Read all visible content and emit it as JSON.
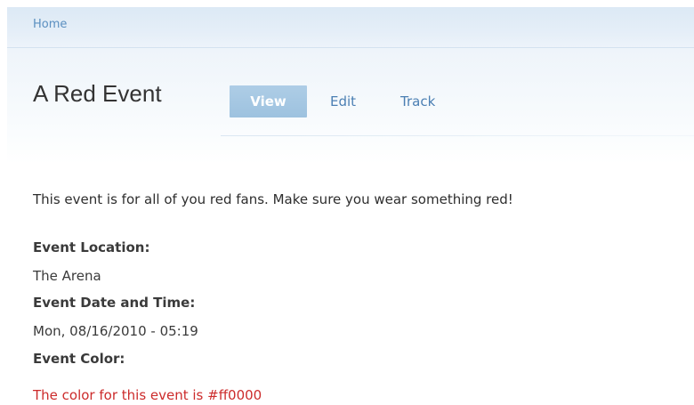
{
  "breadcrumb": {
    "home_label": "Home"
  },
  "header": {
    "title": "A Red Event"
  },
  "tabs": [
    {
      "label": "View",
      "active": true
    },
    {
      "label": "Edit",
      "active": false
    },
    {
      "label": "Track",
      "active": false
    }
  ],
  "content": {
    "description": "This event is for all of you red fans. Make sure you wear something red!",
    "fields": {
      "location_label": "Event Location:",
      "location_value": "The Arena",
      "datetime_label": "Event Date and Time:",
      "datetime_value": "Mon, 08/16/2010 - 05:19",
      "color_label": "Event Color:",
      "color_note": "The color for this event is #ff0000"
    }
  },
  "colors": {
    "accent": "#ff0000",
    "link": "#4b7fb3",
    "active_tab": "#a6c8e3"
  }
}
